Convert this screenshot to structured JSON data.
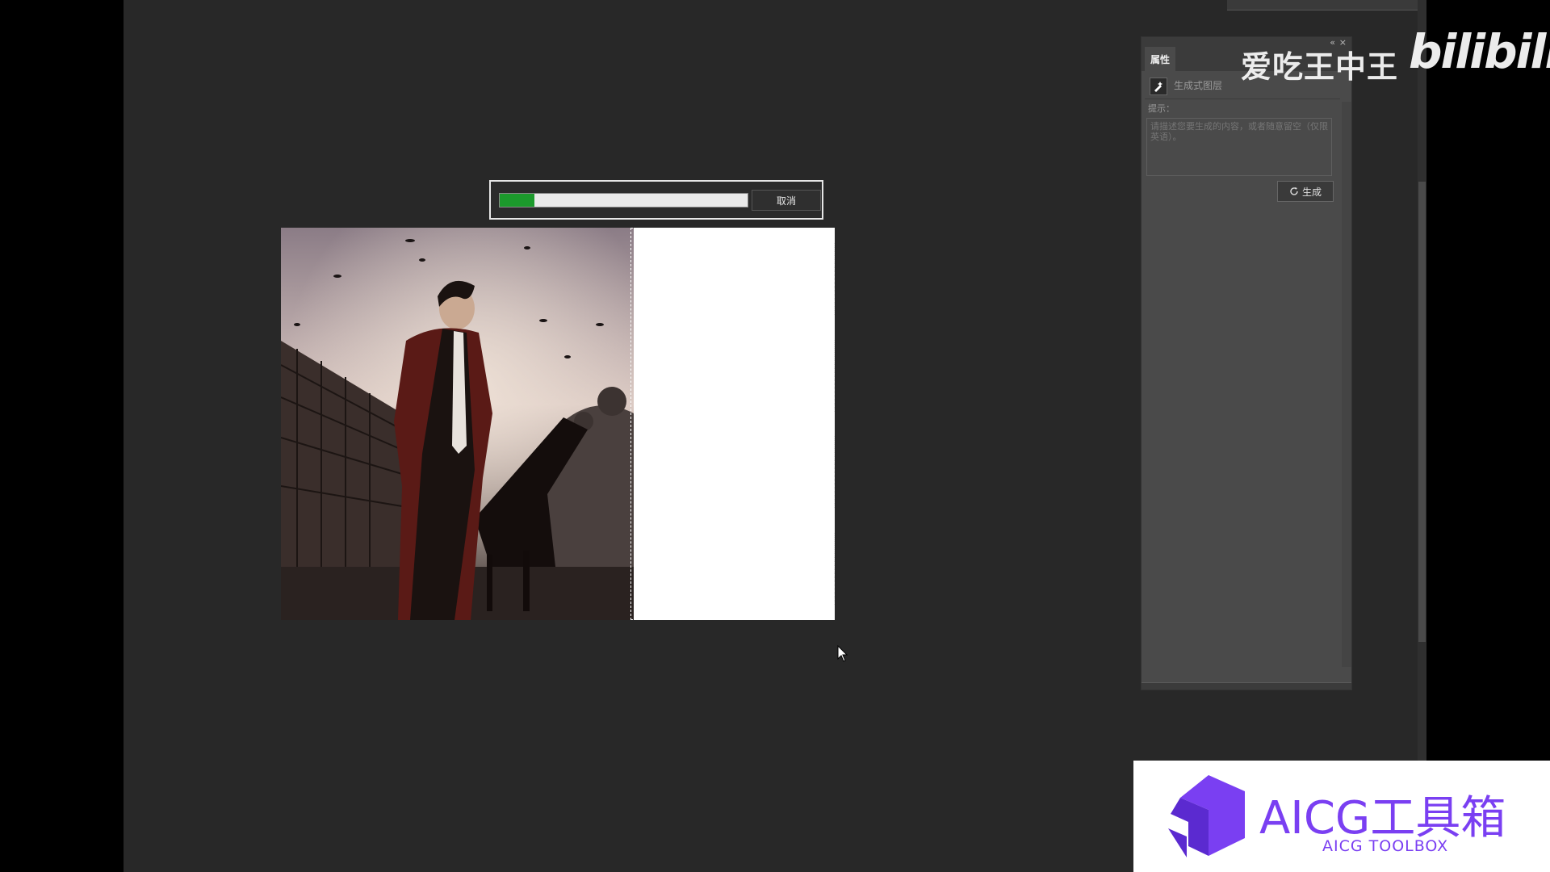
{
  "progress": {
    "percent": 14,
    "cancel_label": "取消"
  },
  "properties_panel": {
    "tab_label": "属性",
    "collapse_icon": "«",
    "close_icon": "×",
    "layer_type_label": "生成式图层",
    "prompt_label": "提示：",
    "prompt_placeholder": "请描述您要生成的内容，或者随意留空（仅限英语）。",
    "generate_label": "生成"
  },
  "watermark": {
    "channel_name": "爱吃王中王",
    "site_logo_text": "bilibili"
  },
  "branding": {
    "title": "AICG工具箱",
    "subtitle": "AICG TOOLBOX",
    "accent_color": "#7a3ff2"
  },
  "colors": {
    "progress_fill": "#1c9a2c",
    "workspace_bg": "#282828"
  }
}
